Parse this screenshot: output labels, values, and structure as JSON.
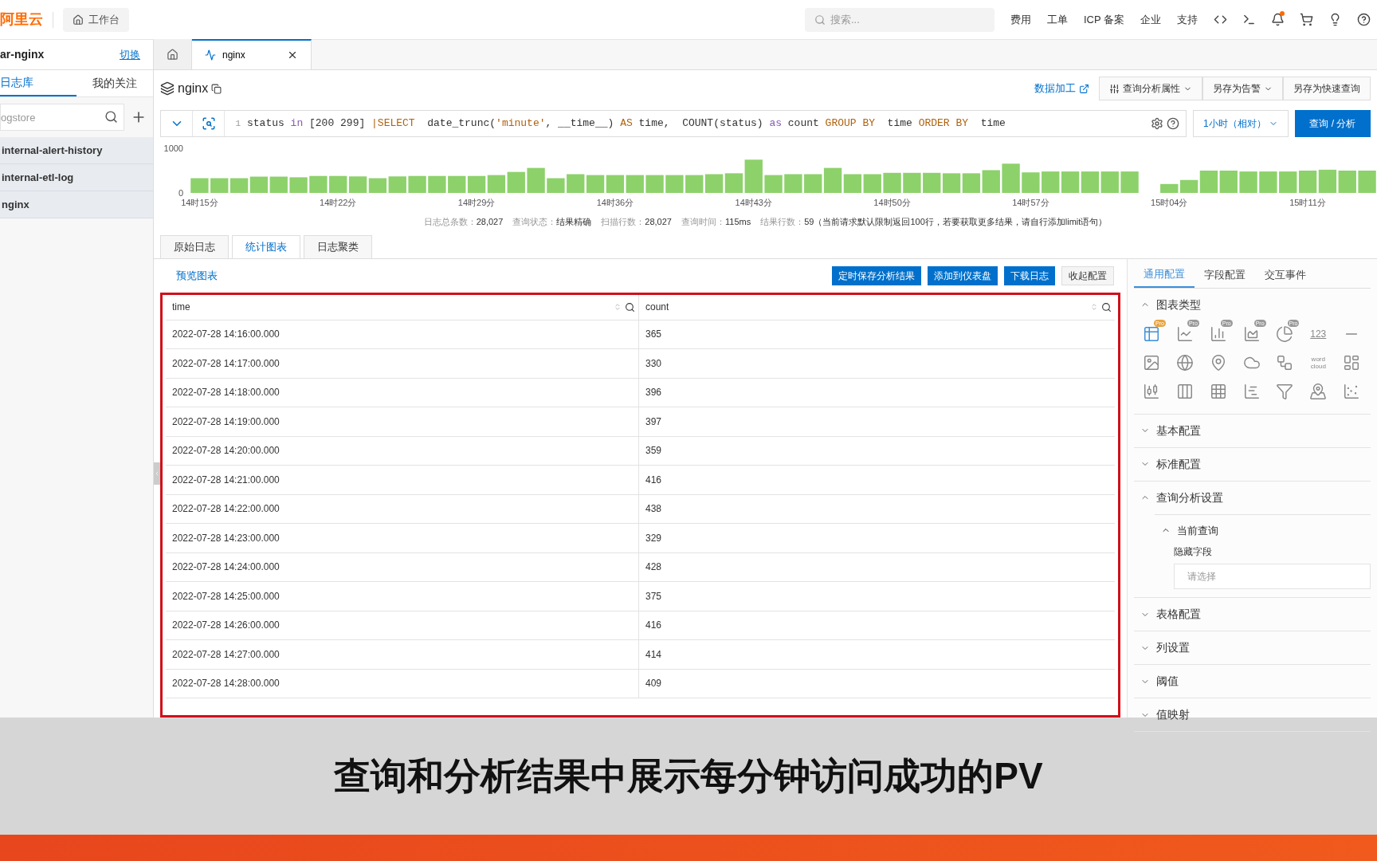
{
  "top_bar": {
    "logo": "阿里云",
    "workbench": "工作台",
    "search_placeholder": "搜索...",
    "links": [
      "费用",
      "工单",
      "ICP 备案",
      "企业",
      "支持"
    ]
  },
  "sidebar": {
    "project": "ar-nginx",
    "switch_link": "切换",
    "tabs": [
      {
        "label": "日志库",
        "selected": true
      },
      {
        "label": "我的关注",
        "selected": false
      }
    ],
    "search_placeholder": "ogstore",
    "items": [
      "internal-alert-history",
      "internal-etl-log",
      "nginx"
    ]
  },
  "page_tabs": [
    {
      "kind": "home",
      "selected": false
    },
    {
      "kind": "query",
      "label": "nginx",
      "selected": true
    }
  ],
  "header": {
    "title": "nginx",
    "data_process_link": "数据加工",
    "actions": [
      {
        "label": "查询分析属性",
        "kind": "menu-icon"
      },
      {
        "label": "另存为告警",
        "kind": "menu"
      },
      {
        "label": "另存为快速查询",
        "kind": "plain"
      }
    ]
  },
  "query": {
    "line_number": "1",
    "tokens": [
      {
        "text": "status ",
        "kind": "plain"
      },
      {
        "text": "in",
        "kind": "operator"
      },
      {
        "text": " [200 299] ",
        "kind": "plain"
      },
      {
        "text": "|SELECT",
        "kind": "keyword"
      },
      {
        "text": "  date_trunc(",
        "kind": "plain"
      },
      {
        "text": "'minute'",
        "kind": "string"
      },
      {
        "text": ", __time__) ",
        "kind": "plain"
      },
      {
        "text": "AS",
        "kind": "keyword"
      },
      {
        "text": " time,  COUNT(status) ",
        "kind": "plain"
      },
      {
        "text": "as",
        "kind": "operator"
      },
      {
        "text": " count ",
        "kind": "plain"
      },
      {
        "text": "GROUP BY",
        "kind": "keyword"
      },
      {
        "text": "  time ",
        "kind": "plain"
      },
      {
        "text": "ORDER BY",
        "kind": "keyword"
      },
      {
        "text": "  time",
        "kind": "plain"
      }
    ],
    "time_range": "1小时（相对）",
    "submit": "查询 / 分析"
  },
  "histogram": {
    "chart_data": {
      "type": "bar",
      "ylim": [
        0,
        1000
      ],
      "yticks": [
        0,
        1000
      ],
      "categories": [
        "14时15分",
        null,
        null,
        null,
        null,
        null,
        null,
        "14时22分",
        null,
        null,
        null,
        null,
        null,
        null,
        "14时29分",
        null,
        null,
        null,
        null,
        null,
        null,
        "14时36分",
        null,
        null,
        null,
        null,
        null,
        null,
        "14时43分",
        null,
        null,
        null,
        null,
        null,
        null,
        "14时50分",
        null,
        null,
        null,
        null,
        null,
        null,
        "14时57分",
        null,
        null,
        null,
        null,
        null,
        null,
        "15时04分",
        null,
        null,
        null,
        null,
        null,
        null,
        "15时11分",
        null,
        null,
        null
      ],
      "values": [
        330,
        330,
        330,
        365,
        365,
        350,
        380,
        380,
        370,
        330,
        370,
        380,
        380,
        380,
        380,
        400,
        470,
        560,
        330,
        420,
        400,
        400,
        400,
        400,
        400,
        400,
        420,
        440,
        745,
        400,
        420,
        420,
        560,
        420,
        420,
        450,
        450,
        450,
        440,
        440,
        510,
        655,
        460,
        480,
        480,
        480,
        480,
        480,
        null,
        200,
        290,
        500,
        500,
        480,
        480,
        480,
        500,
        520,
        500,
        500
      ]
    }
  },
  "stats": [
    {
      "label": "日志总条数：",
      "value": "28,027"
    },
    {
      "label": "查询状态：",
      "value": "结果精确"
    },
    {
      "label": "扫描行数：",
      "value": "28,027"
    },
    {
      "label": "查询时间：",
      "value": "115ms"
    },
    {
      "label": "结果行数：",
      "value": "59（当前请求默认限制返回100行，若要获取更多结果，请自行添加limit语句）"
    }
  ],
  "result_tabs": [
    {
      "label": "原始日志",
      "selected": false
    },
    {
      "label": "统计图表",
      "selected": true
    },
    {
      "label": "日志聚类",
      "selected": false
    }
  ],
  "preview_label": "预览图表",
  "toolbar_buttons": [
    {
      "label": "定时保存分析结果",
      "kind": "primary"
    },
    {
      "label": "添加到仪表盘",
      "kind": "primary"
    },
    {
      "label": "下载日志",
      "kind": "primary"
    },
    {
      "label": "收起配置",
      "kind": "default"
    }
  ],
  "table": {
    "columns": [
      "time",
      "count"
    ],
    "rows": [
      [
        "2022-07-28 14:16:00.000",
        "365"
      ],
      [
        "2022-07-28 14:17:00.000",
        "330"
      ],
      [
        "2022-07-28 14:18:00.000",
        "396"
      ],
      [
        "2022-07-28 14:19:00.000",
        "397"
      ],
      [
        "2022-07-28 14:20:00.000",
        "359"
      ],
      [
        "2022-07-28 14:21:00.000",
        "416"
      ],
      [
        "2022-07-28 14:22:00.000",
        "438"
      ],
      [
        "2022-07-28 14:23:00.000",
        "329"
      ],
      [
        "2022-07-28 14:24:00.000",
        "428"
      ],
      [
        "2022-07-28 14:25:00.000",
        "375"
      ],
      [
        "2022-07-28 14:26:00.000",
        "416"
      ],
      [
        "2022-07-28 14:27:00.000",
        "414"
      ],
      [
        "2022-07-28 14:28:00.000",
        "409"
      ]
    ]
  },
  "config_panel": {
    "tabs": [
      {
        "label": "通用配置",
        "selected": true
      },
      {
        "label": "字段配置",
        "selected": false
      },
      {
        "label": "交互事件",
        "selected": false
      }
    ],
    "sections": [
      {
        "title": "图表类型",
        "expanded": true,
        "kind": "chart_types",
        "chart_types": [
          {
            "kind": "table",
            "badge": "Pro",
            "selected": true
          },
          {
            "kind": "line",
            "badge": "Pro",
            "selected": false
          },
          {
            "kind": "bar",
            "badge": "Pro",
            "selected": false
          },
          {
            "kind": "area",
            "badge": "Pro",
            "selected": false
          },
          {
            "kind": "pie",
            "badge": "Pro",
            "selected": false
          },
          {
            "kind": "number",
            "label": "123",
            "selected": false
          },
          {
            "kind": "progress",
            "selected": false
          },
          {
            "kind": "card",
            "selected": false
          },
          {
            "kind": "world",
            "selected": false
          },
          {
            "kind": "map",
            "selected": false
          },
          {
            "kind": "cloud",
            "selected": false
          },
          {
            "kind": "flow",
            "selected": false
          },
          {
            "kind": "wordcloud",
            "label": "word cloud",
            "selected": false
          },
          {
            "kind": "treemap",
            "selected": false
          },
          {
            "kind": "candle",
            "selected": false
          },
          {
            "kind": "columns",
            "selected": false
          },
          {
            "kind": "grid",
            "selected": false
          },
          {
            "kind": "gantt",
            "selected": false
          },
          {
            "kind": "funnel",
            "selected": false
          },
          {
            "kind": "pin",
            "selected": false
          },
          {
            "kind": "scatter",
            "selected": false
          }
        ]
      },
      {
        "title": "基本配置",
        "expanded": false
      },
      {
        "title": "标准配置",
        "expanded": false
      },
      {
        "title": "查询分析设置",
        "expanded": true,
        "kind": "query_settings",
        "subsections": [
          {
            "title": "当前查询",
            "expanded": true,
            "field_label": "隐藏字段",
            "placeholder": "请选择"
          }
        ]
      },
      {
        "title": "表格配置",
        "expanded": false
      },
      {
        "title": "列设置",
        "expanded": false
      },
      {
        "title": "阈值",
        "expanded": false
      },
      {
        "title": "值映射",
        "expanded": false
      }
    ]
  },
  "caption": "查询和分析结果中展示每分钟访问成功的PV"
}
